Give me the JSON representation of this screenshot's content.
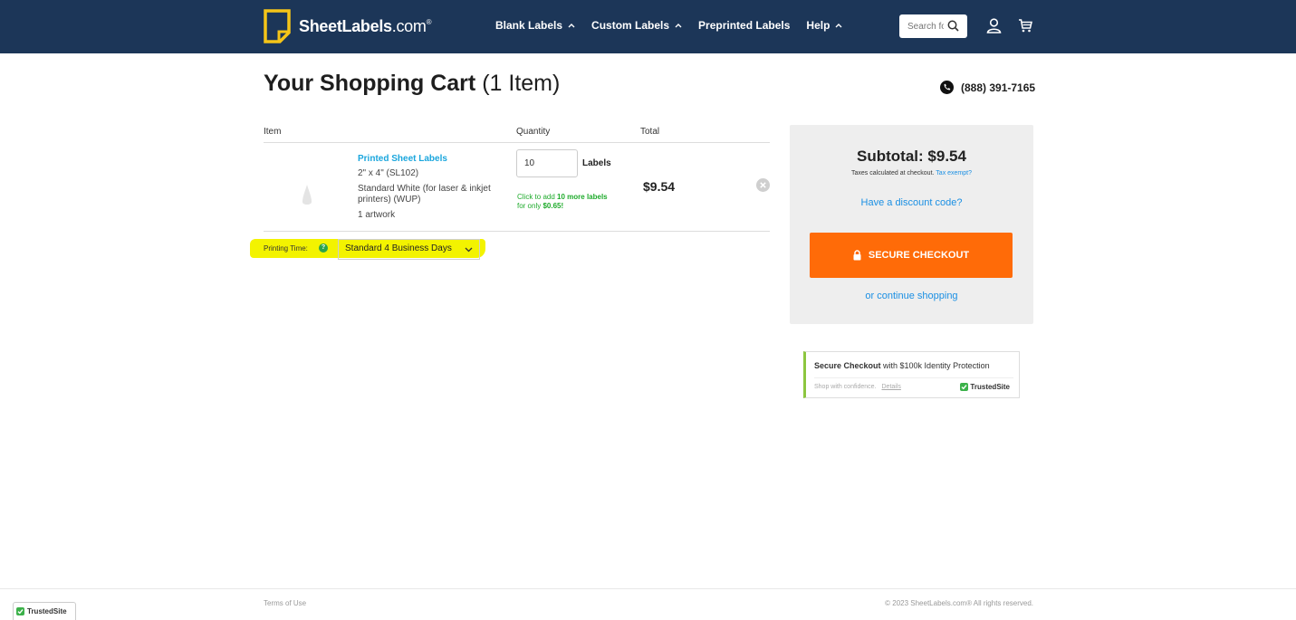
{
  "header": {
    "logo": {
      "name": "SheetLabels",
      "tld": ".com",
      "mark": "®"
    },
    "nav": [
      {
        "label": "Blank Labels",
        "has_dropdown": true
      },
      {
        "label": "Custom Labels",
        "has_dropdown": true
      },
      {
        "label": "Preprinted Labels",
        "has_dropdown": false
      },
      {
        "label": "Help",
        "has_dropdown": true
      }
    ],
    "search": {
      "placeholder": "Search for",
      "icon": "search-icon"
    },
    "icons": [
      "user-icon",
      "cart-icon"
    ]
  },
  "cart": {
    "title": "Your Shopping Cart",
    "count": "(1 Item)",
    "phone": "(888) 391-7165",
    "columns": {
      "item": "Item",
      "quantity": "Quantity",
      "total": "Total"
    },
    "item": {
      "name": "Printed Sheet Labels",
      "size": "2\" x 4\" (SL102)",
      "material_line1": "Standard White (for laser & inkjet",
      "material_line2": "printers) (WUP)",
      "artwork": "1 artwork",
      "quantity": "10",
      "unit": "Labels",
      "upsell_prefix": "Click to add ",
      "upsell_bold": "10 more labels",
      "upsell_mid": "for only ",
      "upsell_price": "$0.65!",
      "total": "$9.54"
    },
    "printing_time": {
      "label": "Printing Time:",
      "help": "?",
      "selected": "Standard 4 Business Days"
    }
  },
  "summary": {
    "subtotal": "Subtotal: $9.54",
    "tax_note": "Taxes calculated at checkout.",
    "tax_exempt": "Tax exempt?",
    "discount": "Have a discount code?",
    "checkout": "SECURE CHECKOUT",
    "continue": "or continue shopping"
  },
  "trusted_site": {
    "title_bold": "Secure Checkout",
    "title_rest": " with $100k Identity Protection",
    "sub": "Shop with confidence.",
    "details": "Details",
    "brand": "TrustedSite"
  },
  "footer": {
    "terms": "Terms of Use",
    "copyright": "© 2023 SheetLabels.com® All rights reserved.",
    "badge": "TrustedSite"
  },
  "colors": {
    "header_bg": "#1c3658",
    "logo_yellow": "#f5c518",
    "link_blue": "#1a8fe3",
    "checkout_orange": "#ff6b08",
    "upsell_green": "#1fab2c",
    "highlight_yellow": "#f3f300"
  }
}
